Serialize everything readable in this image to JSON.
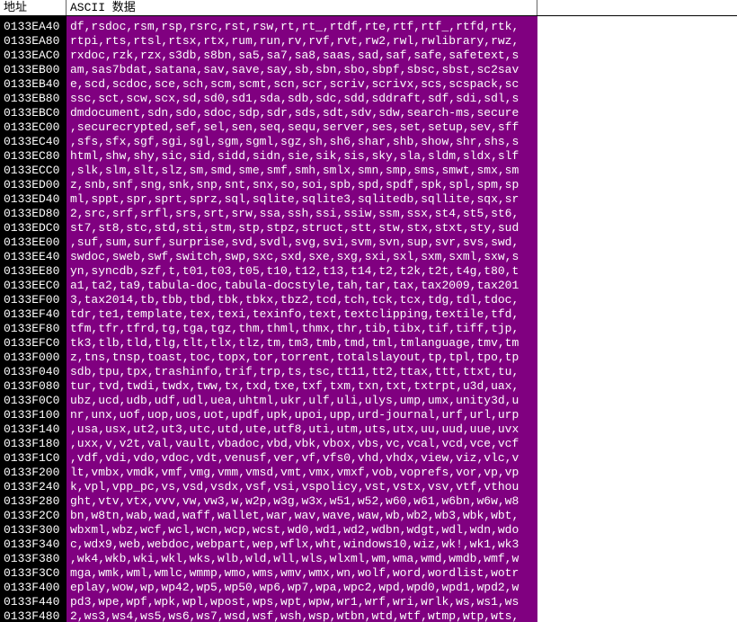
{
  "header": {
    "address": "地址",
    "ascii_data": "ASCII 数据"
  },
  "rows": [
    {
      "addr": "0133EA40",
      "data": "df,rsdoc,rsm,rsp,rsrc,rst,rsw,rt,rt_,rtdf,rte,rtf,rtf_,rtfd,rtk,"
    },
    {
      "addr": "0133EA80",
      "data": "rtpi,rts,rtsl,rtsx,rtx,rum,run,rv,rvf,rvt,rw2,rwl,rwlibrary,rwz,"
    },
    {
      "addr": "0133EAC0",
      "data": "rxdoc,rzk,rzx,s3db,s8bn,sa5,sa7,sa8,saas,sad,saf,safe,safetext,s"
    },
    {
      "addr": "0133EB00",
      "data": "am,sas7bdat,satana,sav,save,say,sb,sbn,sbo,sbpf,sbsc,sbst,sc2sav"
    },
    {
      "addr": "0133EB40",
      "data": "e,scd,scdoc,sce,sch,scm,scmt,scn,scr,scriv,scrivx,scs,scspack,sc"
    },
    {
      "addr": "0133EB80",
      "data": "ssc,sct,scw,scx,sd,sd0,sd1,sda,sdb,sdc,sdd,sddraft,sdf,sdi,sdl,s"
    },
    {
      "addr": "0133EBC0",
      "data": "dmdocument,sdn,sdo,sdoc,sdp,sdr,sds,sdt,sdv,sdw,search-ms,secure"
    },
    {
      "addr": "0133EC00",
      "data": ",securecrypted,sef,sel,sen,seq,sequ,server,ses,set,setup,sev,sff"
    },
    {
      "addr": "0133EC40",
      "data": ",sfs,sfx,sgf,sgi,sgl,sgm,sgml,sgz,sh,sh6,shar,shb,show,shr,shs,s"
    },
    {
      "addr": "0133EC80",
      "data": "html,shw,shy,sic,sid,sidd,sidn,sie,sik,sis,sky,sla,sldm,sldx,slf"
    },
    {
      "addr": "0133ECC0",
      "data": ",slk,slm,slt,slz,sm,smd,sme,smf,smh,smlx,smn,smp,sms,smwt,smx,sm"
    },
    {
      "addr": "0133ED00",
      "data": "z,snb,snf,sng,snk,snp,snt,snx,so,soi,spb,spd,spdf,spk,spl,spm,sp"
    },
    {
      "addr": "0133ED40",
      "data": "ml,sppt,spr,sprt,sprz,sql,sqlite,sqlite3,sqlitedb,sqllite,sqx,sr"
    },
    {
      "addr": "0133ED80",
      "data": "2,src,srf,srfl,srs,srt,srw,ssa,ssh,ssi,ssiw,ssm,ssx,st4,st5,st6,"
    },
    {
      "addr": "0133EDC0",
      "data": "st7,st8,stc,std,sti,stm,stp,stpz,struct,stt,stw,stx,stxt,sty,sud"
    },
    {
      "addr": "0133EE00",
      "data": ",suf,sum,surf,surprise,svd,svdl,svg,svi,svm,svn,sup,svr,svs,swd,"
    },
    {
      "addr": "0133EE40",
      "data": "swdoc,sweb,swf,switch,swp,sxc,sxd,sxe,sxg,sxi,sxl,sxm,sxml,sxw,s"
    },
    {
      "addr": "0133EE80",
      "data": "yn,syncdb,szf,t,t01,t03,t05,t10,t12,t13,t14,t2,t2k,t2t,t4g,t80,t"
    },
    {
      "addr": "0133EEC0",
      "data": "a1,ta2,ta9,tabula-doc,tabula-docstyle,tah,tar,tax,tax2009,tax201"
    },
    {
      "addr": "0133EF00",
      "data": "3,tax2014,tb,tbb,tbd,tbk,tbkx,tbz2,tcd,tch,tck,tcx,tdg,tdl,tdoc,"
    },
    {
      "addr": "0133EF40",
      "data": "tdr,te1,template,tex,texi,texinfo,text,textclipping,textile,tfd,"
    },
    {
      "addr": "0133EF80",
      "data": "tfm,tfr,tfrd,tg,tga,tgz,thm,thml,thmx,thr,tib,tibx,tif,tiff,tjp,"
    },
    {
      "addr": "0133EFC0",
      "data": "tk3,tlb,tld,tlg,tlt,tlx,tlz,tm,tm3,tmb,tmd,tml,tmlanguage,tmv,tm"
    },
    {
      "addr": "0133F000",
      "data": "z,tns,tnsp,toast,toc,topx,tor,torrent,totalslayout,tp,tpl,tpo,tp"
    },
    {
      "addr": "0133F040",
      "data": "sdb,tpu,tpx,trashinfo,trif,trp,ts,tsc,tt11,tt2,ttax,ttt,ttxt,tu,"
    },
    {
      "addr": "0133F080",
      "data": "tur,tvd,twdi,twdx,tww,tx,txd,txe,txf,txm,txn,txt,txtrpt,u3d,uax,"
    },
    {
      "addr": "0133F0C0",
      "data": "ubz,ucd,udb,udf,udl,uea,uhtml,ukr,ulf,uli,ulys,ump,umx,unity3d,u"
    },
    {
      "addr": "0133F100",
      "data": "nr,unx,uof,uop,uos,uot,updf,upk,upoi,upp,urd-journal,urf,url,urp"
    },
    {
      "addr": "0133F140",
      "data": ",usa,usx,ut2,ut3,utc,utd,ute,utf8,uti,utm,uts,utx,uu,uud,uue,uvx"
    },
    {
      "addr": "0133F180",
      "data": ",uxx,v,v2t,val,vault,vbadoc,vbd,vbk,vbox,vbs,vc,vcal,vcd,vce,vcf"
    },
    {
      "addr": "0133F1C0",
      "data": ",vdf,vdi,vdo,vdoc,vdt,venusf,ver,vf,vfs0,vhd,vhdx,view,viz,vlc,v"
    },
    {
      "addr": "0133F200",
      "data": "lt,vmbx,vmdk,vmf,vmg,vmm,vmsd,vmt,vmx,vmxf,vob,voprefs,vor,vp,vp"
    },
    {
      "addr": "0133F240",
      "data": "k,vpl,vpp_pc,vs,vsd,vsdx,vsf,vsi,vspolicy,vst,vstx,vsv,vtf,vthou"
    },
    {
      "addr": "0133F280",
      "data": "ght,vtv,vtx,vvv,vw,vw3,w,w2p,w3g,w3x,w51,w52,w60,w61,w6bn,w6w,w8"
    },
    {
      "addr": "0133F2C0",
      "data": "bn,w8tn,wab,wad,waff,wallet,war,wav,wave,waw,wb,wb2,wb3,wbk,wbt,"
    },
    {
      "addr": "0133F300",
      "data": "wbxml,wbz,wcf,wcl,wcn,wcp,wcst,wd0,wd1,wd2,wdbn,wdgt,wdl,wdn,wdo"
    },
    {
      "addr": "0133F340",
      "data": "c,wdx9,web,webdoc,webpart,wep,wflx,wht,windows10,wiz,wk!,wk1,wk3"
    },
    {
      "addr": "0133F380",
      "data": ",wk4,wkb,wki,wkl,wks,wlb,wld,wll,wls,wlxml,wm,wma,wmd,wmdb,wmf,w"
    },
    {
      "addr": "0133F3C0",
      "data": "mga,wmk,wml,wmlc,wmmp,wmo,wms,wmv,wmx,wn,wolf,word,wordlist,wotr"
    },
    {
      "addr": "0133F400",
      "data": "eplay,wow,wp,wp42,wp5,wp50,wp6,wp7,wpa,wpc2,wpd,wpd0,wpd1,wpd2,w"
    },
    {
      "addr": "0133F440",
      "data": "pd3,wpe,wpf,wpk,wpl,wpost,wps,wpt,wpw,wr1,wrf,wri,wrlk,ws,ws1,ws"
    },
    {
      "addr": "0133F480",
      "data": "2,ws3,ws4,ws5,ws6,ws7,wsd,wsf,wsh,wsp,wtbn,wtd,wtf,wtmp,wtp,wts,"
    }
  ]
}
